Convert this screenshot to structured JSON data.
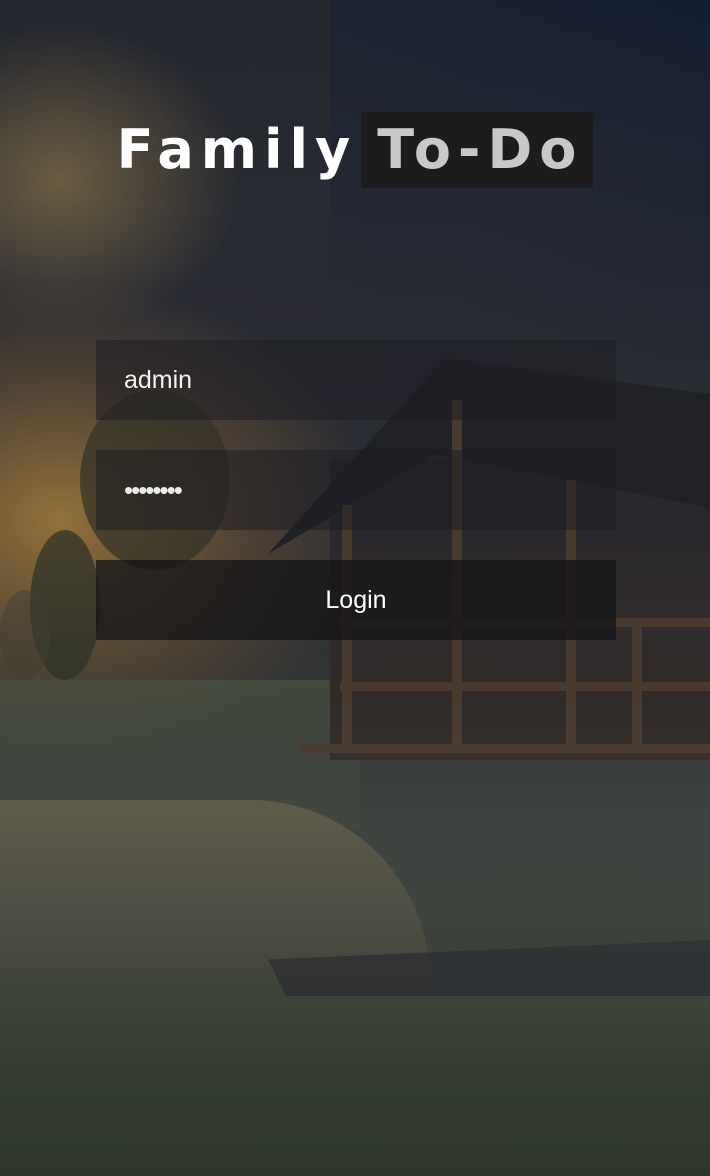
{
  "app": {
    "title_part1": "Family",
    "title_part2": "To-Do"
  },
  "login_form": {
    "username": {
      "value": "admin"
    },
    "password": {
      "masked_value": "••••••••"
    },
    "submit_label": "Login"
  },
  "colors": {
    "title_primary": "#ffffff",
    "title_secondary": "#c8c8c8",
    "title_highlight_bg": "#1c1c1e",
    "field_bg": "rgba(30,30,34,0.55)",
    "button_bg": "rgba(22,22,24,0.78)"
  }
}
